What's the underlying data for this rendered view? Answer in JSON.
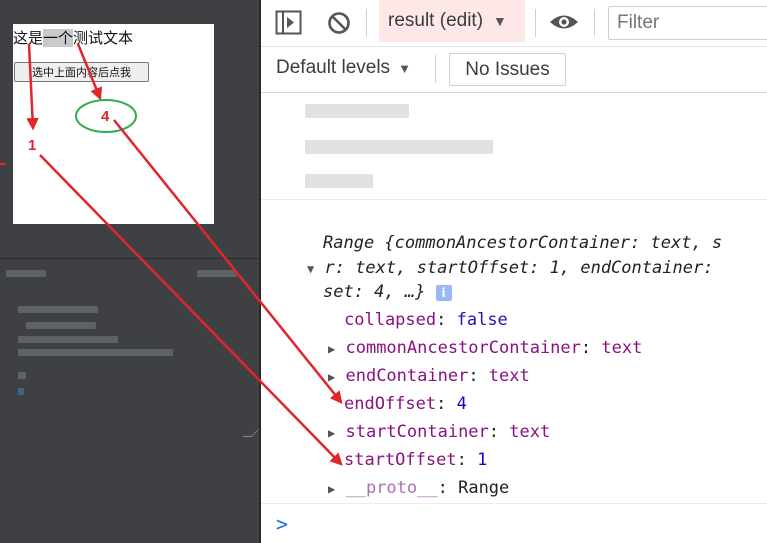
{
  "preview": {
    "text_before": "这是",
    "text_selected": "一个",
    "text_after": "测试文本",
    "button_label": "选中上面内容后点我"
  },
  "toolbar": {
    "context": "result (edit)",
    "filter_placeholder": "Filter",
    "levels": "Default levels",
    "issues": "No Issues"
  },
  "console": {
    "header_line1_start": "Range {commonAncestorContainer: text, s",
    "header_line2_start": "r: text, startOffset: 1, endContainer: ",
    "header_line3": "set: 4, …}",
    "info": "i",
    "props": [
      {
        "key": "collapsed",
        "value": "false"
      },
      {
        "key": "commonAncestorContainer",
        "value": "text"
      },
      {
        "key": "endContainer",
        "value": "text"
      },
      {
        "key": "endOffset",
        "value": "4"
      },
      {
        "key": "startContainer",
        "value": "text"
      },
      {
        "key": "startOffset",
        "value": "1"
      },
      {
        "key": "__proto__",
        "value": "Range"
      }
    ],
    "prompt": ">"
  },
  "annotations": {
    "label_1": "1",
    "label_4": "4",
    "color": "#e0262b",
    "ellipse_color": "#2fae4e"
  }
}
